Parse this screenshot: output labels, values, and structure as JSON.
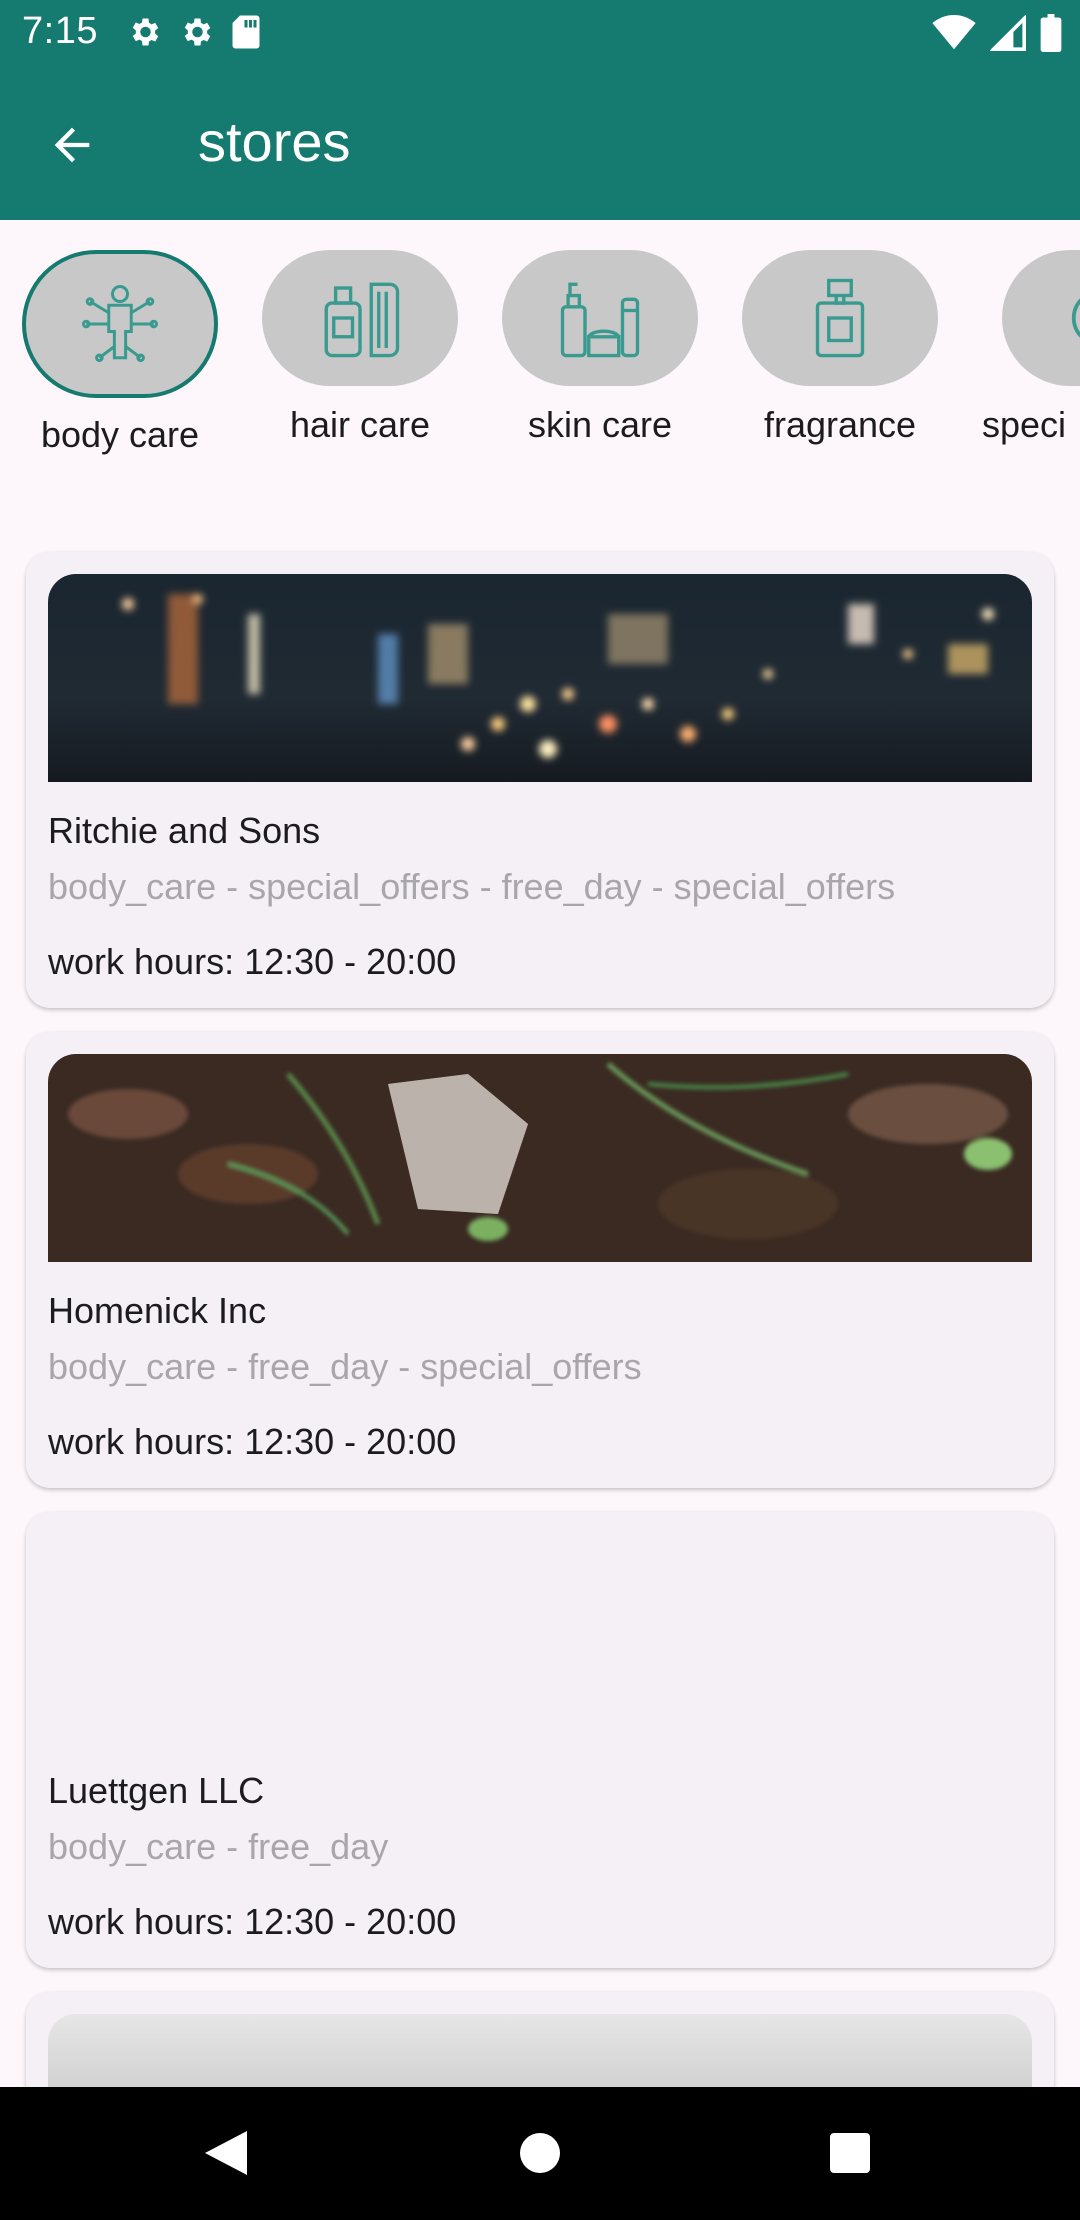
{
  "status_bar": {
    "time": "7:15",
    "left_icons": [
      "gear-icon",
      "gear-icon",
      "sd-card-icon"
    ],
    "right_icons": [
      "wifi-icon",
      "signal-icon",
      "battery-icon"
    ]
  },
  "app_bar": {
    "title": "stores",
    "back_icon": "arrow-back-icon",
    "color": "#157a6f"
  },
  "categories": [
    {
      "label": "body care",
      "icon": "body-icon",
      "active": true
    },
    {
      "label": "hair care",
      "icon": "hair-care-icon",
      "active": false
    },
    {
      "label": "skin care",
      "icon": "skin-care-icon",
      "active": false
    },
    {
      "label": "fragrance",
      "icon": "perfume-icon",
      "active": false
    },
    {
      "label": "speci",
      "icon": "special-icon",
      "active": false
    }
  ],
  "stores": [
    {
      "name": "Ritchie and Sons",
      "tags": "body_care  - special_offers  - free_day  - special_offers",
      "hours": "work hours: 12:30  - 20:00",
      "image": "night-city-street-photo"
    },
    {
      "name": "Homenick Inc",
      "tags": "body_care  - free_day  - special_offers",
      "hours": "work hours: 12:30  - 20:00",
      "image": "rock-on-ground-photo"
    },
    {
      "name": "Luettgen LLC",
      "tags": "body_care  - free_day",
      "hours": "work hours: 12:30  - 20:00",
      "image": ""
    }
  ],
  "nav_bar": {
    "buttons": [
      "back-triangle-icon",
      "home-circle-icon",
      "recents-square-icon"
    ]
  }
}
